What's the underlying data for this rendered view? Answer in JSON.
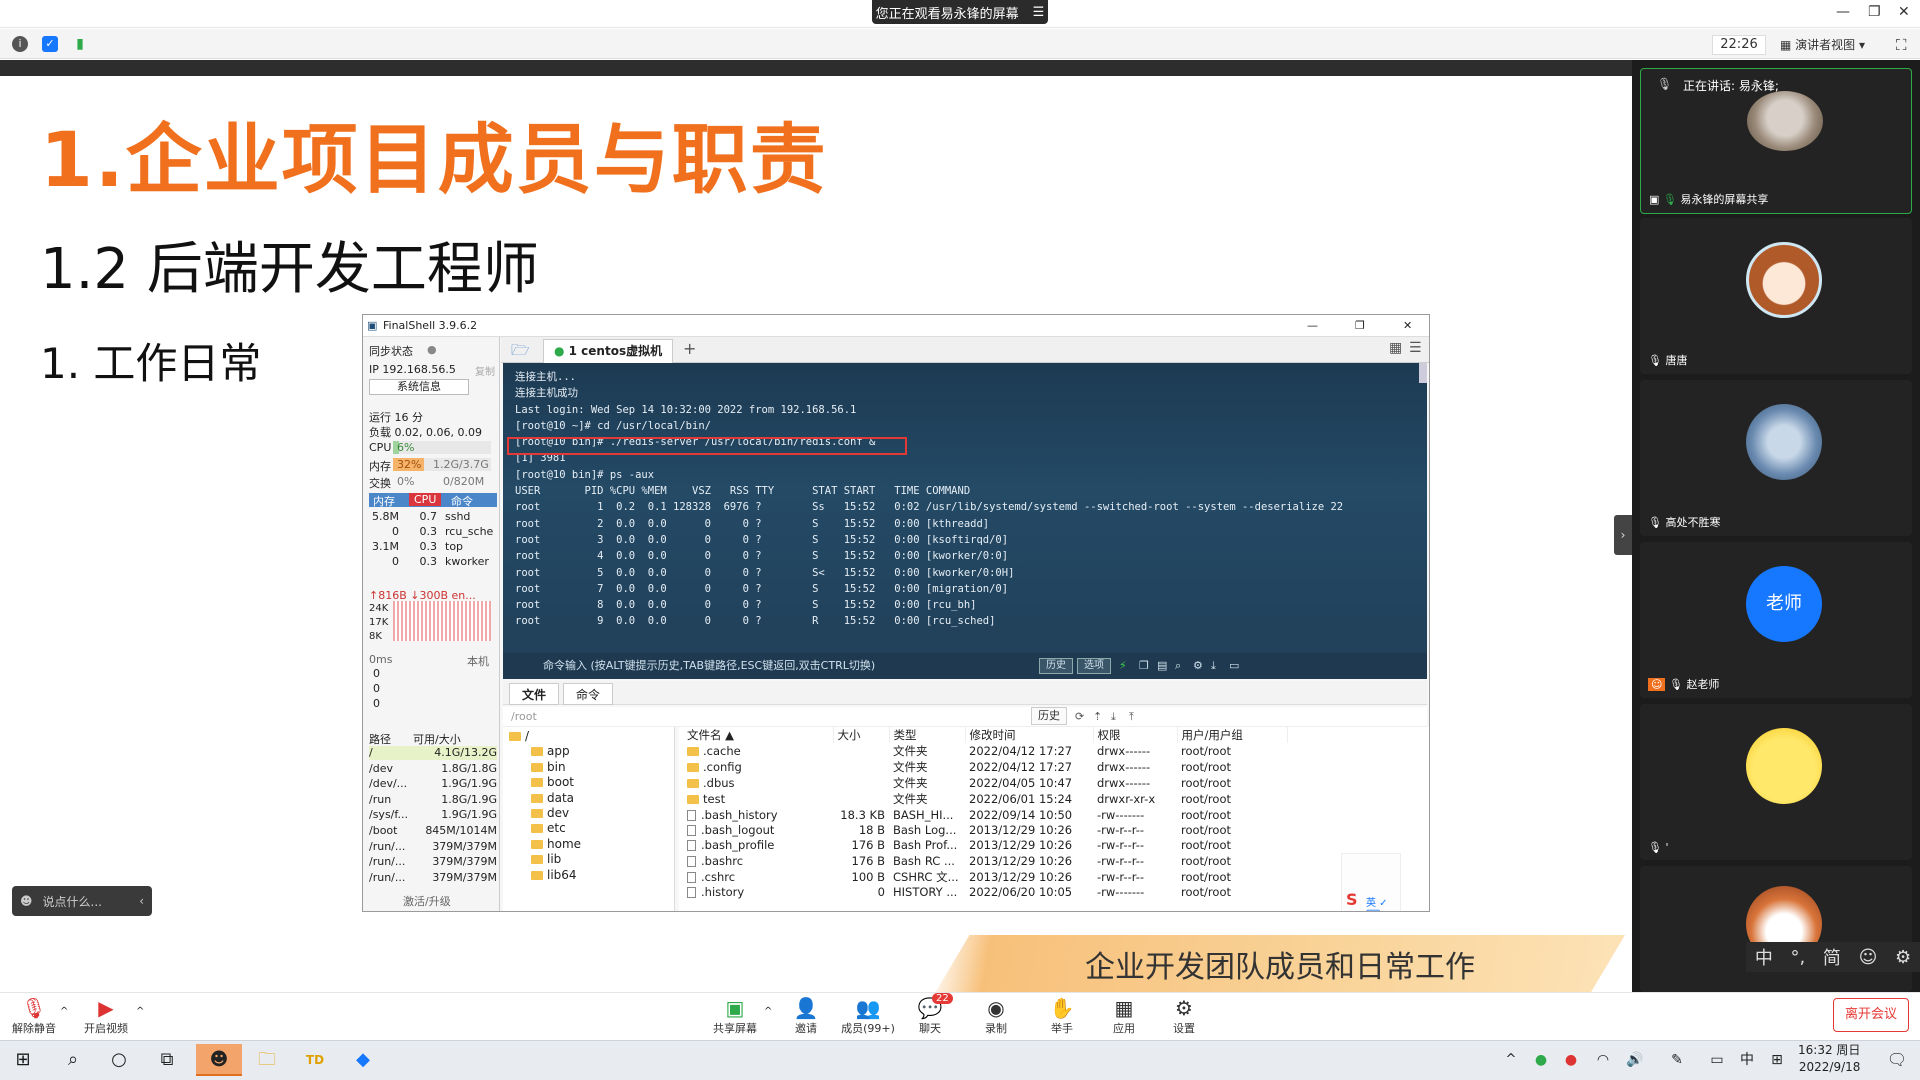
{
  "meeting": {
    "banner": "您正在观看易永锋的屏幕",
    "clock": "22:26",
    "view_mode": "演讲者视图",
    "speaking": "正在讲话: 易永锋;",
    "share_label": "易永锋的屏幕共享",
    "chat_placeholder": "说点什么...",
    "leave": "离开会议",
    "toolbar": {
      "mute": "解除静音",
      "video": "开启视频",
      "share": "共享屏幕",
      "invite": "邀请",
      "members": "成员(99+)",
      "chat": "聊天",
      "chat_badge": "22",
      "record": "录制",
      "raise": "举手",
      "apps": "应用",
      "settings": "设置"
    },
    "participants": [
      {
        "name": "唐唐"
      },
      {
        "name": "高处不胜寒"
      },
      {
        "name": "赵老师",
        "avatar_text": "老师"
      },
      {
        "name": "'"
      }
    ],
    "ime": {
      "zh": "中",
      "punct": "°,",
      "simple": "简",
      "emoji": "☺",
      "gear": "⚙"
    }
  },
  "slide": {
    "title": "1.企业项目成员与职责",
    "subtitle": "1.2 后端开发工程师",
    "item": "1. 工作日常",
    "bottom_banner": "企业开发团队成员和日常工作"
  },
  "finalshell": {
    "title": "FinalShell 3.9.6.2",
    "sync": "同步状态",
    "ip": "IP 192.168.56.5",
    "copy": "复制",
    "sysinfo": "系统信息",
    "uptime": "运行 16 分",
    "load": "负载 0.02, 0.06, 0.09",
    "cpu_label": "CPU",
    "cpu_val": "6%",
    "mem_label": "内存",
    "mem_pct": "32%",
    "mem_val": "1.2G/3.7G",
    "swap_label": "交换",
    "swap_pct": "0%",
    "swap_val": "0/820M",
    "proc_headers": [
      "内存",
      "CPU",
      "命令"
    ],
    "procs": [
      {
        "mem": "5.8M",
        "cpu": "0.7",
        "cmd": "sshd"
      },
      {
        "mem": "0",
        "cpu": "0.3",
        "cmd": "rcu_sche"
      },
      {
        "mem": "3.1M",
        "cpu": "0.3",
        "cmd": "top"
      },
      {
        "mem": "0",
        "cpu": "0.3",
        "cmd": "kworker"
      }
    ],
    "net": "↑816B ↓300B  en...",
    "net_scale": [
      "24K",
      "17K",
      "8K"
    ],
    "ping": "0ms",
    "ping_host": "本机",
    "ping_vals": [
      "0",
      "0",
      "0"
    ],
    "disk_headers": [
      "路径",
      "可用/大小"
    ],
    "disks": [
      {
        "path": "/",
        "size": "4.1G/13.2G"
      },
      {
        "path": "/dev",
        "size": "1.8G/1.8G"
      },
      {
        "path": "/dev/...",
        "size": "1.9G/1.9G"
      },
      {
        "path": "/run",
        "size": "1.8G/1.9G"
      },
      {
        "path": "/sys/f...",
        "size": "1.9G/1.9G"
      },
      {
        "path": "/boot",
        "size": "845M/1014M"
      },
      {
        "path": "/run/...",
        "size": "379M/379M"
      },
      {
        "path": "/run/...",
        "size": "379M/379M"
      },
      {
        "path": "/run/...",
        "size": "379M/379M"
      }
    ],
    "activate": "激活/升级",
    "tab": "1 centos虚拟机",
    "terminal": [
      "连接主机...",
      "连接主机成功",
      "Last login: Wed Sep 14 10:32:00 2022 from 192.168.56.1",
      "[root@10 ~]# cd /usr/local/bin/",
      "[root@10 bin]# ./redis-server /usr/local/bin/redis.conf &",
      "[1] 3981",
      "[root@10 bin]# ps -aux",
      "USER       PID %CPU %MEM    VSZ   RSS TTY      STAT START   TIME COMMAND",
      "root         1  0.2  0.1 128328  6976 ?        Ss   15:52   0:02 /usr/lib/systemd/systemd --switched-root --system --deserialize 22",
      "root         2  0.0  0.0      0     0 ?        S    15:52   0:00 [kthreadd]",
      "root         3  0.0  0.0      0     0 ?        S    15:52   0:00 [ksoftirqd/0]",
      "root         4  0.0  0.0      0     0 ?        S    15:52   0:00 [kworker/0:0]",
      "root         5  0.0  0.0      0     0 ?        S<   15:52   0:00 [kworker/0:0H]",
      "root         7  0.0  0.0      0     0 ?        S    15:52   0:00 [migration/0]",
      "root         8  0.0  0.0      0     0 ?        S    15:52   0:00 [rcu_bh]",
      "root         9  0.0  0.0      0     0 ?        R    15:52   0:00 [rcu_sched]"
    ],
    "cmd_hint": "命令输入 (按ALT键提示历史,TAB键路径,ESC键返回,双击CTRL切换)",
    "btn_history": "历史",
    "btn_options": "选项",
    "btab_files": "文件",
    "btab_cmd": "命令",
    "path": "/root",
    "history": "历史",
    "tree": [
      "/",
      "app",
      "bin",
      "boot",
      "data",
      "dev",
      "etc",
      "home",
      "lib",
      "lib64"
    ],
    "file_headers": [
      "文件名 ▲",
      "大小",
      "类型",
      "修改时间",
      "权限",
      "用户/用户组"
    ],
    "files": [
      {
        "name": ".cache",
        "size": "",
        "type": "文件夹",
        "time": "2022/04/12 17:27",
        "perm": "drwx------",
        "owner": "root/root",
        "dir": true
      },
      {
        "name": ".config",
        "size": "",
        "type": "文件夹",
        "time": "2022/04/12 17:27",
        "perm": "drwx------",
        "owner": "root/root",
        "dir": true
      },
      {
        "name": ".dbus",
        "size": "",
        "type": "文件夹",
        "time": "2022/04/05 10:47",
        "perm": "drwx------",
        "owner": "root/root",
        "dir": true
      },
      {
        "name": "test",
        "size": "",
        "type": "文件夹",
        "time": "2022/06/01 15:24",
        "perm": "drwxr-xr-x",
        "owner": "root/root",
        "dir": true
      },
      {
        "name": ".bash_history",
        "size": "18.3 KB",
        "type": "BASH_HI...",
        "time": "2022/09/14 10:50",
        "perm": "-rw-------",
        "owner": "root/root",
        "dir": false
      },
      {
        "name": ".bash_logout",
        "size": "18 B",
        "type": "Bash Log...",
        "time": "2013/12/29 10:26",
        "perm": "-rw-r--r--",
        "owner": "root/root",
        "dir": false
      },
      {
        "name": ".bash_profile",
        "size": "176 B",
        "type": "Bash Prof...",
        "time": "2013/12/29 10:26",
        "perm": "-rw-r--r--",
        "owner": "root/root",
        "dir": false
      },
      {
        "name": ".bashrc",
        "size": "176 B",
        "type": "Bash RC ...",
        "time": "2013/12/29 10:26",
        "perm": "-rw-r--r--",
        "owner": "root/root",
        "dir": false
      },
      {
        "name": ".cshrc",
        "size": "100 B",
        "type": "CSHRC 文...",
        "time": "2013/12/29 10:26",
        "perm": "-rw-r--r--",
        "owner": "root/root",
        "dir": false
      },
      {
        "name": ".history",
        "size": "0",
        "type": "HISTORY ...",
        "time": "2022/06/20 10:05",
        "perm": "-rw-------",
        "owner": "root/root",
        "dir": false
      }
    ]
  },
  "taskbar": {
    "tray_zh": "中",
    "time": "16:32 周日",
    "date": "2022/9/18"
  },
  "colors": {
    "accent_orange": "#f0701e",
    "teacher_blue": "#1677ff",
    "leave_red": "#e53935"
  }
}
